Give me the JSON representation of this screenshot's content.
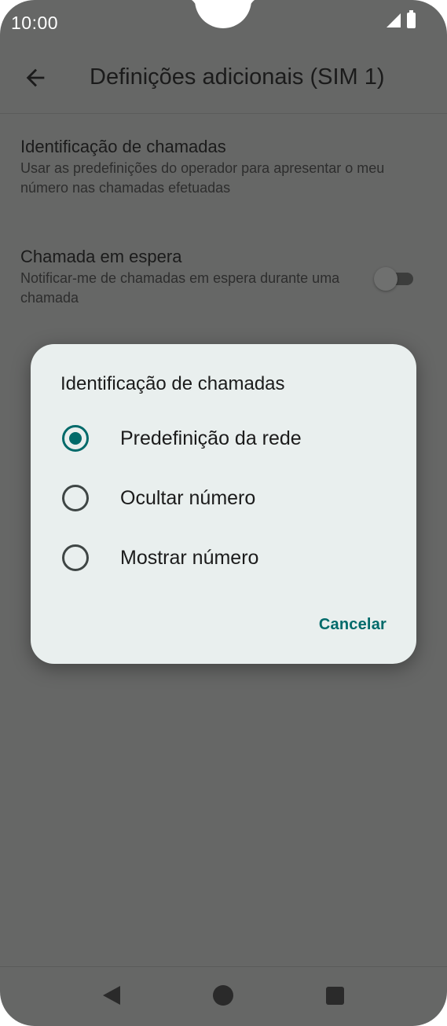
{
  "status_bar": {
    "time": "10:00",
    "icons": [
      "signal-icon",
      "battery-icon"
    ]
  },
  "app_bar": {
    "back_icon": "arrow-left-icon",
    "title": "Definições adicionais (SIM 1)"
  },
  "settings": [
    {
      "title": "Identificação de chamadas",
      "summary": "Usar as predefinições do operador para apresentar o meu número nas chamadas efetuadas"
    },
    {
      "title": "Chamada em espera",
      "summary": "Notificar-me de chamadas em espera durante uma chamada",
      "toggle_on": false
    }
  ],
  "dialog": {
    "title": "Identificação de chamadas",
    "options": [
      {
        "label": "Predefinição da rede",
        "selected": true
      },
      {
        "label": "Ocultar número",
        "selected": false
      },
      {
        "label": "Mostrar número",
        "selected": false
      }
    ],
    "cancel_label": "Cancelar"
  },
  "nav_bar": {
    "icons": [
      "nav-back-icon",
      "nav-home-icon",
      "nav-recents-icon"
    ]
  },
  "colors": {
    "accent": "#006a6a",
    "scrim_background": "#666766",
    "dialog_background": "#e9efee"
  }
}
